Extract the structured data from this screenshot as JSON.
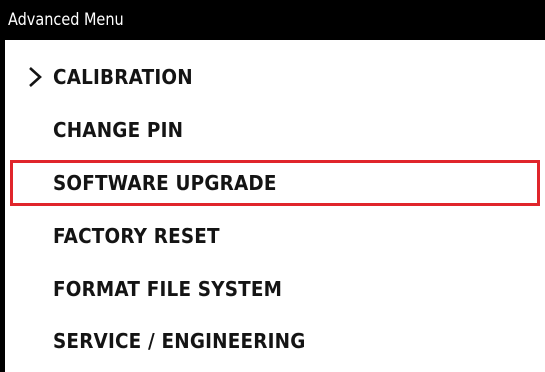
{
  "window": {
    "title": "Advanced Menu"
  },
  "menu": {
    "cursor_icon": "chevron-right-icon",
    "selected_highlight_color": "#e0252b",
    "selected_index": 2,
    "items": [
      {
        "label": "CALIBRATION",
        "has_cursor": true
      },
      {
        "label": "CHANGE PIN"
      },
      {
        "label": "SOFTWARE UPGRADE",
        "selected": true
      },
      {
        "label": "FACTORY RESET"
      },
      {
        "label": "FORMAT FILE SYSTEM"
      },
      {
        "label": "SERVICE / ENGINEERING"
      }
    ]
  }
}
